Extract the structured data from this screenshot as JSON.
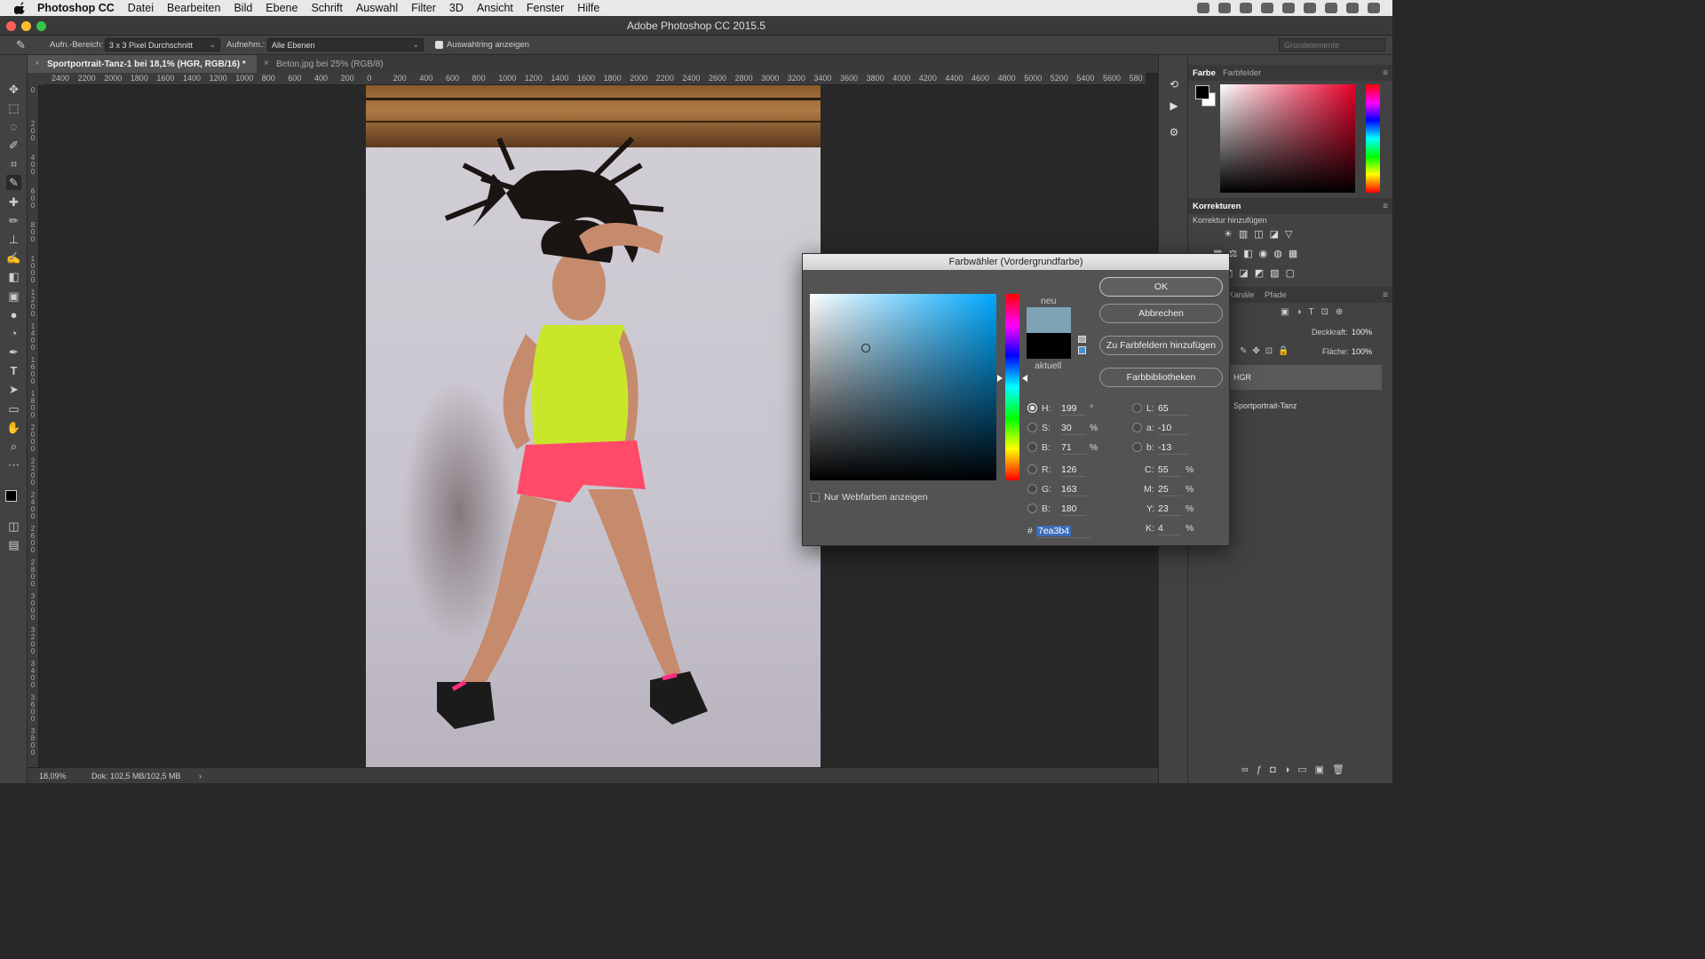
{
  "menubar": {
    "app_name": "Photoshop CC",
    "items": [
      "Datei",
      "Bearbeiten",
      "Bild",
      "Ebene",
      "Schrift",
      "Auswahl",
      "Filter",
      "3D",
      "Ansicht",
      "Fenster",
      "Hilfe"
    ]
  },
  "window": {
    "title": "Adobe Photoshop CC 2015.5"
  },
  "options": {
    "sample_size_label": "Aufn.-Bereich:",
    "sample_size_value": "3 x 3 Pixel Durchschnitt",
    "sample_label": "Aufnehm.:",
    "sample_value": "Alle Ebenen",
    "show_ring_label": "Auswahlring anzeigen",
    "workspace_placeholder": "Grundelemente"
  },
  "tabs": [
    {
      "label": "Sportportrait-Tanz-1 bei 18,1% (HGR, RGB/16) *"
    },
    {
      "label": "Beton.jpg bei 25% (RGB/8)"
    }
  ],
  "ruler": {
    "top_ticks": [
      "2400",
      "2200",
      "2000",
      "1800",
      "1600",
      "1400",
      "1200",
      "1000",
      "800",
      "600",
      "400",
      "200",
      "0",
      "200",
      "400",
      "600",
      "800",
      "1000",
      "1200",
      "1400",
      "1600",
      "1800",
      "2000",
      "2200",
      "2400",
      "2600",
      "2800",
      "3000",
      "3200",
      "3400",
      "3600",
      "3800",
      "4000",
      "4200",
      "4400",
      "4600",
      "4800",
      "5000",
      "5200",
      "5400",
      "5600",
      "580"
    ],
    "left_ticks": [
      "0",
      "200",
      "400",
      "600",
      "800",
      "1000",
      "1200",
      "1400",
      "1600",
      "1800",
      "2000",
      "2200",
      "2400",
      "2600",
      "2800",
      "3000",
      "3200",
      "3400",
      "3600",
      "3800"
    ]
  },
  "status": {
    "zoom": "18,09%",
    "doc": "Dok: 102,5 MB/102,5 MB",
    "arrow": "›"
  },
  "right_panel": {
    "color_tabs": [
      "Farbe",
      "Farbfelder"
    ],
    "adjustments_title": "Korrekturen",
    "adjustments_subtitle": "Korrektur hinzufügen",
    "layer_tabs": [
      "Kanäle",
      "Pfade"
    ],
    "opacity_label": "Deckkraft:",
    "opacity_value": "100%",
    "fill_label": "Fläche:",
    "fill_value": "100%",
    "layers": [
      "HGR",
      "Sportportrait-Tanz"
    ]
  },
  "dialog": {
    "title": "Farbwähler (Vordergrundfarbe)",
    "new_label": "neu",
    "current_label": "aktuell",
    "new_color": "#7ea3b4",
    "current_color": "#000000",
    "buttons": {
      "ok": "OK",
      "cancel": "Abbrechen",
      "add_swatches": "Zu Farbfeldern hinzufügen",
      "libraries": "Farbbibliotheken"
    },
    "web_only_label": "Nur Webfarben anzeigen",
    "hsb": {
      "H": "199",
      "S": "30",
      "B": "71",
      "h_unit": "°",
      "pct": "%"
    },
    "rgb": {
      "R": "126",
      "G": "163",
      "B": "180"
    },
    "lab": {
      "L": "65",
      "a": "-10",
      "b": "-13"
    },
    "cmyk": {
      "C": "55",
      "M": "25",
      "Y": "23",
      "K": "4"
    },
    "hex_prefix": "#",
    "hex": "7ea3b4",
    "labels": {
      "H": "H:",
      "S": "S:",
      "Bh": "B:",
      "R": "R:",
      "G": "G:",
      "Bb": "B:",
      "L": "L:",
      "a": "a:",
      "b": "b:",
      "C": "C:",
      "M": "M:",
      "Y": "Y:",
      "K": "K:"
    }
  },
  "colors": {
    "accent": "#3d6db8",
    "close": "#fc5f57",
    "minimize": "#fdbc2e",
    "zoom": "#33c748"
  }
}
